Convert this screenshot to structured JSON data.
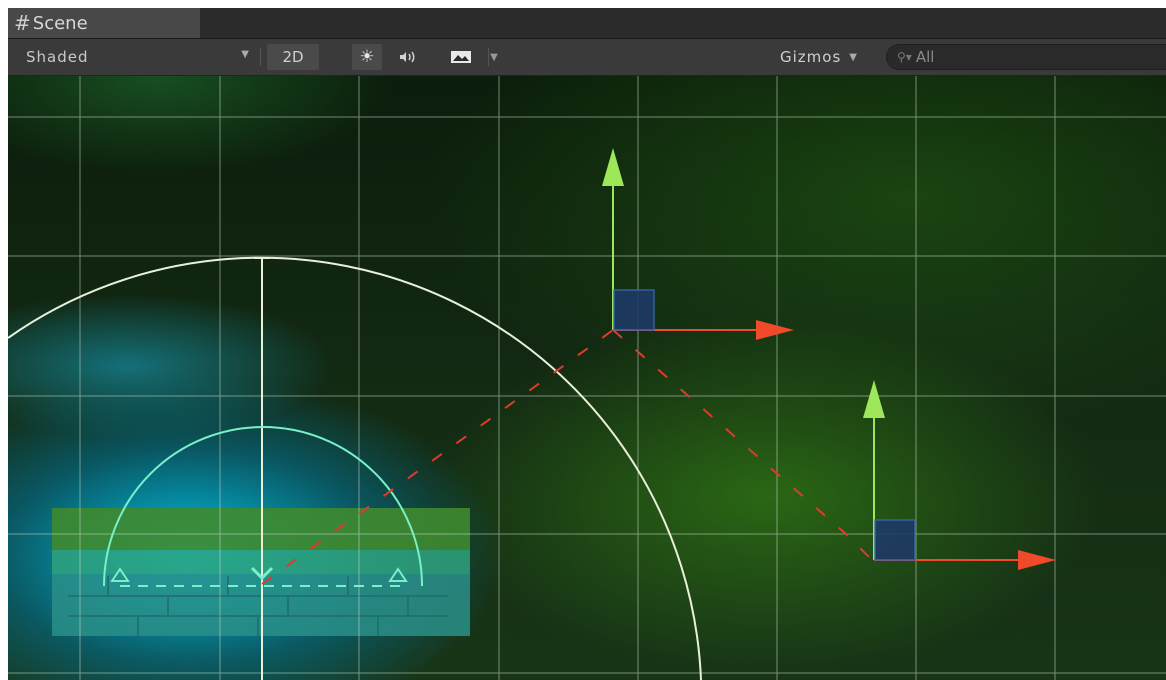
{
  "tab": {
    "icon": "grid-hash-icon",
    "title": "Scene"
  },
  "toolbar": {
    "shading_mode": "Shaded",
    "btn_2d": "2D",
    "lighting_icon": "sun-icon",
    "audio_icon": "speaker-icon",
    "effects_icon": "image-icon",
    "gizmos_label": "Gizmos",
    "search_placeholder": "All"
  },
  "colors": {
    "gizmo_up": "#9ee65a",
    "gizmo_right": "#f04a2a",
    "gizmo_handle": "#2d5aa8",
    "dashed_link": "#e03a2a",
    "grid": "#c9d8c9"
  }
}
